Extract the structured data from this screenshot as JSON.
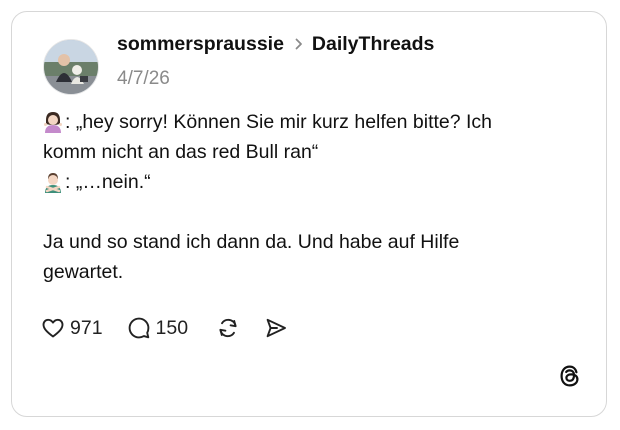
{
  "post": {
    "username": "sommerspraussie",
    "community": "DailyThreads",
    "date": "4/7/26",
    "lines": {
      "speaker1_line1": ": „hey sorry! Können Sie mir kurz helfen bitte? Ich",
      "speaker1_line2": "komm nicht an das red Bull ran“",
      "speaker2_line1": ": „…nein.“",
      "closing_line1": "Ja und so stand ich dann da. Und habe auf Hilfe",
      "closing_line2": "gewartet."
    },
    "icons": {
      "speaker1": "woman-shrugging-emoji",
      "speaker2": "man-gesturing-no-emoji"
    }
  },
  "actions": {
    "likes": "971",
    "replies": "150"
  },
  "colors": {
    "border": "#d7d7d7",
    "text": "#111111",
    "muted": "#8a8a8a"
  }
}
